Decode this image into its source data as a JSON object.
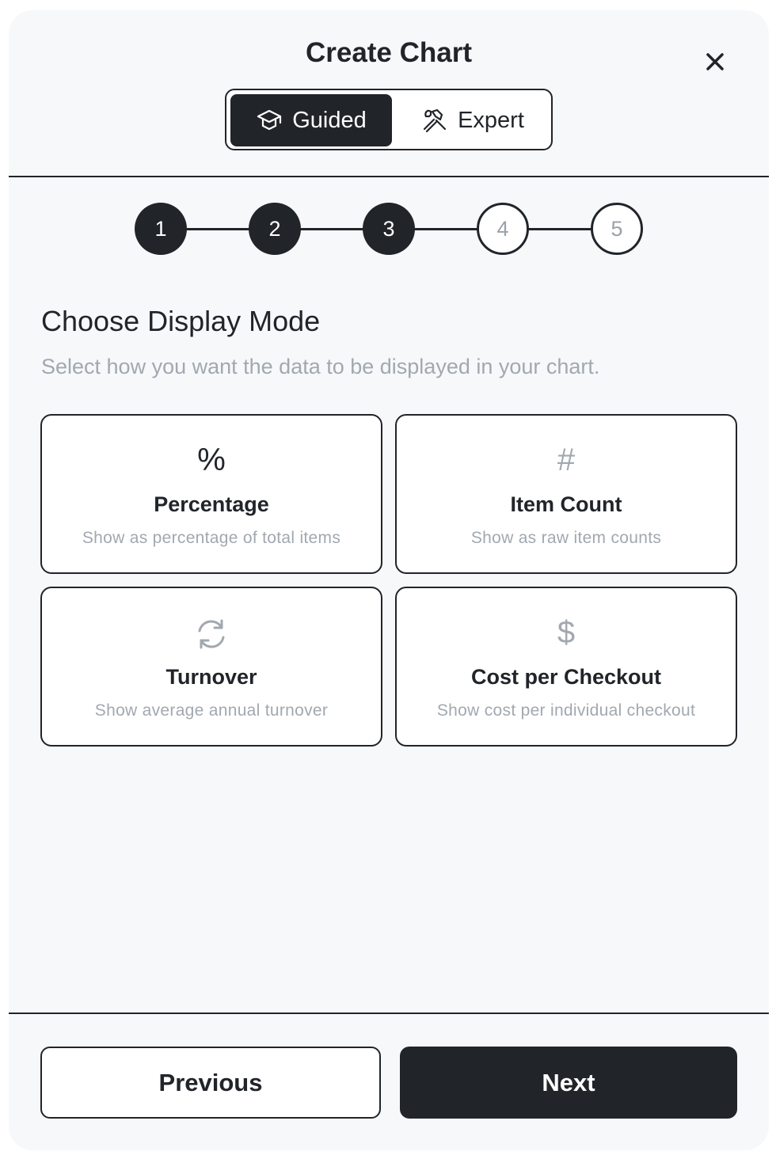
{
  "header": {
    "title": "Create Chart",
    "close_icon": "close-icon",
    "modes": [
      {
        "label": "Guided",
        "icon": "graduation-cap-icon",
        "selected": true
      },
      {
        "label": "Expert",
        "icon": "tools-icon",
        "selected": false
      }
    ]
  },
  "stepper": {
    "current_step": 3,
    "steps": [
      {
        "label": "1",
        "state": "done"
      },
      {
        "label": "2",
        "state": "done"
      },
      {
        "label": "3",
        "state": "done"
      },
      {
        "label": "4",
        "state": "todo"
      },
      {
        "label": "5",
        "state": "todo"
      }
    ]
  },
  "section": {
    "title": "Choose Display Mode",
    "subtitle": "Select how you want the data to be displayed in your chart."
  },
  "options": [
    {
      "icon_text": "%",
      "icon": "percent-icon",
      "title": "Percentage",
      "description": "Show as percentage of total items"
    },
    {
      "icon_text": "#",
      "icon": "hash-icon",
      "title": "Item Count",
      "description": "Show as raw item counts"
    },
    {
      "icon_text": "",
      "icon": "refresh-icon",
      "title": "Turnover",
      "description": "Show average annual turnover"
    },
    {
      "icon_text": "$",
      "icon": "dollar-icon",
      "title": "Cost per Checkout",
      "description": "Show cost per individual checkout"
    }
  ],
  "footer": {
    "previous_label": "Previous",
    "next_label": "Next"
  },
  "colors": {
    "primary": "#212429",
    "background": "#f7f8fa",
    "muted_text": "#a2a8b0"
  }
}
